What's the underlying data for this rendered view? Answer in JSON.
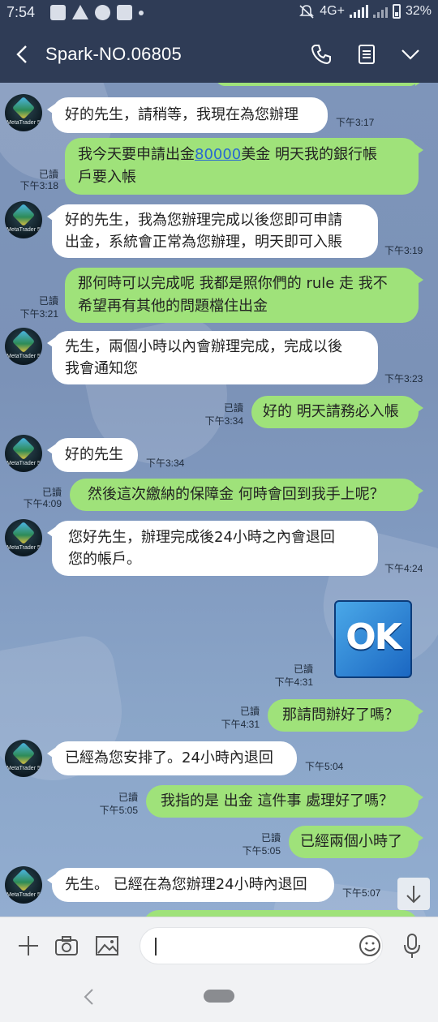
{
  "status_bar": {
    "time": "7:54",
    "network": "4G+",
    "battery": "32%"
  },
  "header": {
    "title": "Spark-NO.06805"
  },
  "avatar_label": "MetaTrader 5",
  "messages": [
    {
      "side": "in",
      "text1": "好的先生，請稍等，我現在為您辦理",
      "time": "下午3:17"
    },
    {
      "side": "out",
      "text1a": "我今天要申請出金",
      "link": "80000",
      "text1b": "美金 明天我的銀行帳",
      "text2": "戶要入帳",
      "read": "已讀",
      "time": "下午3:18"
    },
    {
      "side": "in",
      "text1": "好的先生，我為您辦理完成以後您即可申請",
      "text2": "出金，系統會正常為您辦理，明天即可入賬",
      "time": "下午3:19"
    },
    {
      "side": "out",
      "text1": "那何時可以完成呢 我都是照你們的 rule 走 我不",
      "text2": "希望再有其他的問題檔住出金",
      "read": "已讀",
      "time": "下午3:21"
    },
    {
      "side": "in",
      "text1": "先生，兩個小時以內會辦理完成，完成以後",
      "text2": "我會通知您",
      "time": "下午3:23"
    },
    {
      "side": "out",
      "text1": "好的 明天請務必入帳",
      "read": "已讀",
      "time": "下午3:34"
    },
    {
      "side": "in",
      "text1": "好的先生",
      "time": "下午3:34"
    },
    {
      "side": "out",
      "text1": "然後這次繳納的保障金 何時會回到我手上呢？",
      "read": "已讀",
      "time": "下午4:09"
    },
    {
      "side": "in",
      "text1": "您好先生，辦理完成後24小時之內會退回",
      "text2": "您的帳戶。",
      "time": "下午4:24"
    },
    {
      "side": "out",
      "sticker": "OK",
      "read": "已讀",
      "time": "下午4:31"
    },
    {
      "side": "out",
      "text1": "那請問辦好了嗎？",
      "read": "已讀",
      "time": "下午4:31"
    },
    {
      "side": "in",
      "text1": "已經為您安排了。24小時內退回",
      "time": "下午5:04"
    },
    {
      "side": "out",
      "text1": "我指的是 出金 這件事 處理好了嗎？",
      "read": "已讀",
      "time": "下午5:05"
    },
    {
      "side": "out",
      "text1": "已經兩個小時了",
      "read": "已讀",
      "time": "下午5:05"
    },
    {
      "side": "in",
      "text1": "先生。 已經在為您辦理24小時內退回",
      "time": "下午5:07"
    }
  ],
  "icons": {
    "back": "chevron-left-icon",
    "call": "phone-icon",
    "notes": "notes-icon",
    "menu": "chevron-down-icon",
    "add": "plus-icon",
    "camera": "camera-icon",
    "image": "image-icon",
    "emoji": "emoji-icon",
    "voice": "microphone-icon",
    "scroll": "arrow-down-icon"
  },
  "colors": {
    "header_bg": "#2f3c56",
    "chat_bg": "#7e95ba",
    "outgoing_bubble": "#9fe27a",
    "incoming_bubble": "#ffffff",
    "link": "#2a6ad0"
  }
}
